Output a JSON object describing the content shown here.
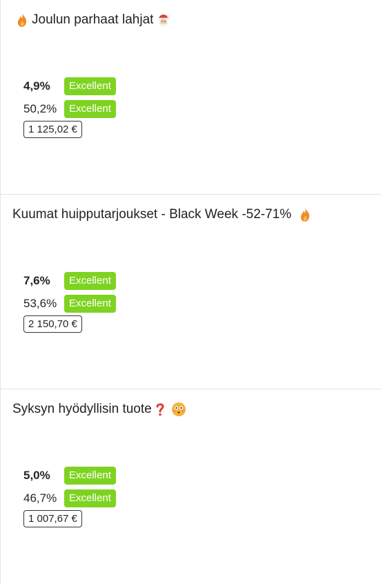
{
  "cards": [
    {
      "title": "Joulun parhaat lahjat",
      "leading_icon": "fire-icon",
      "trailing_icon": "santa-icon",
      "metric1": {
        "value": "4,9%",
        "badge": "Excellent"
      },
      "metric2": {
        "value": "50,2%",
        "badge": "Excellent"
      },
      "price": "1 125,02 €"
    },
    {
      "title": "Kuumat huipputarjoukset - Black Week -52-71%",
      "trailing_icon": "fire-icon",
      "metric1": {
        "value": "7,6%",
        "badge": "Excellent"
      },
      "metric2": {
        "value": "53,6%",
        "badge": "Excellent"
      },
      "price": "2 150,70 €"
    },
    {
      "title": "Syksyn hyödyllisin tuote",
      "trailing_icons": [
        "question-mark-icon",
        "flushed-face-icon"
      ],
      "metric1": {
        "value": "5,0%",
        "badge": "Excellent"
      },
      "metric2": {
        "value": "46,7%",
        "badge": "Excellent"
      },
      "price": "1 007,67 €"
    }
  ],
  "colors": {
    "badge": "#7ed321",
    "fire": "#f08a2a",
    "question": "#d9403a",
    "face": "#f5b33a"
  }
}
